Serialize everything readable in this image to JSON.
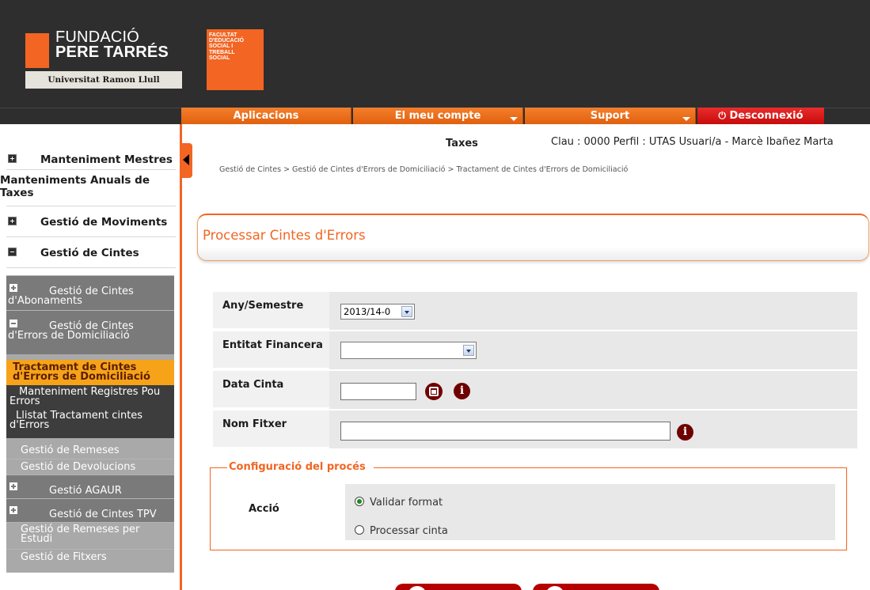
{
  "header": {
    "logo_name_line1": "FUNDACIÓ",
    "logo_name_line2": "PERE TARRÉS",
    "logo_university": "Universitat Ramon Llull",
    "faculty_line1": "FACULTAT",
    "faculty_line2": "D'EDUCACIÓ",
    "faculty_line3": "SOCIAL I",
    "faculty_line4": "TREBALL",
    "faculty_line5": "SOCIAL"
  },
  "menu": {
    "applications": "Aplicacions",
    "account": "El meu compte",
    "support": "Suport",
    "logout": "Desconnexió"
  },
  "sidebar": {
    "items": [
      {
        "label": "Manteniment Mestres"
      },
      {
        "label": "Manteniments Anuals de Taxes"
      },
      {
        "label": "Gestió de Moviments"
      },
      {
        "label": "Gestió de Cintes"
      }
    ],
    "sub": {
      "abonaments": "Gestió de Cintes d'Abonaments",
      "errors": "Gestió de Cintes d'Errors de Domiciliació",
      "tractament": "Tractament de Cintes d'Errors de Domiciliació",
      "manteniment": "Manteniment Registres Pou Errors",
      "llistat": "Llistat Tractament cintes d'Errors",
      "remeses": "Gestió de Remeses",
      "devolucions": "Gestió de Devolucions",
      "agaur": "Gestió AGAUR",
      "tpv": "Gestió de Cintes TPV",
      "remeses_estudi": "Gestió de Remeses per Estudi",
      "fitxers": "Gestió de Fitxers"
    }
  },
  "page": {
    "section": "Taxes",
    "user_info": "Clau : 0000  Perfil : UTAS  Usuari/a - Marcè Ibañez Marta",
    "breadcrumb": "Gestió de Cintes > Gestió de Cintes d'Errors de Domiciliació > Tractament de Cintes d'Errors de Domiciliació",
    "title": "Processar Cintes d'Errors"
  },
  "form": {
    "any_label": "Any/Semestre",
    "any_value": "2013/14-0",
    "entitat_label": "Entitat Financera",
    "entitat_value": "",
    "data_label": "Data Cinta",
    "data_value": "",
    "fitxer_label": "Nom Fitxer",
    "fitxer_value": ""
  },
  "config": {
    "legend": "Configuració del procés",
    "accio_label": "Acció",
    "option_validate": "Validar format",
    "option_process": "Processar cinta",
    "selected": "Validar format"
  },
  "colors": {
    "accent": "#f26522",
    "header_bg": "#2e2e2e",
    "logout": "#d21010",
    "active_item": "#f6a31a"
  }
}
